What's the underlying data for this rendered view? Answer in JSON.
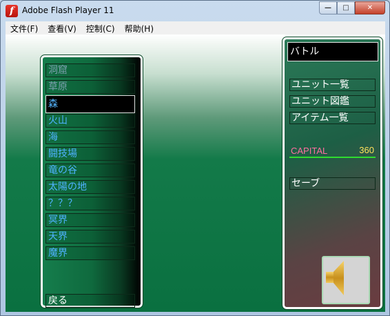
{
  "window": {
    "title": "Adobe Flash Player 11"
  },
  "caption_buttons": {
    "minimize": "—",
    "maximize": "□",
    "close": "✕"
  },
  "menu": [
    "文件(F)",
    "查看(V)",
    "控制(C)",
    "帮助(H)"
  ],
  "locations": [
    {
      "label": "洞窟",
      "state": "gray"
    },
    {
      "label": "草原",
      "state": "gray"
    },
    {
      "label": "森",
      "state": "active"
    },
    {
      "label": "火山",
      "state": "normal"
    },
    {
      "label": "海",
      "state": "normal"
    },
    {
      "label": "闘技場",
      "state": "normal"
    },
    {
      "label": "竜の谷",
      "state": "normal"
    },
    {
      "label": "太陽の地",
      "state": "normal"
    },
    {
      "label": "？？？",
      "state": "normal"
    },
    {
      "label": "冥界",
      "state": "normal"
    },
    {
      "label": "天界",
      "state": "normal"
    },
    {
      "label": "魔界",
      "state": "normal"
    }
  ],
  "back_label": "戻る",
  "mode_label": "バトル",
  "side_menu": [
    "ユニット一覧",
    "ユニット図鑑",
    "アイテム一覧"
  ],
  "capital": {
    "label": "CAPITAL",
    "value": "360"
  },
  "save_label": "セーブ",
  "sound_icon": "speaker-icon",
  "colors": {
    "location_blue": "#4fb1ff",
    "capital_label": "#ff6fa0",
    "capital_value": "#ffe25a",
    "capital_line": "#2fdc2f"
  }
}
